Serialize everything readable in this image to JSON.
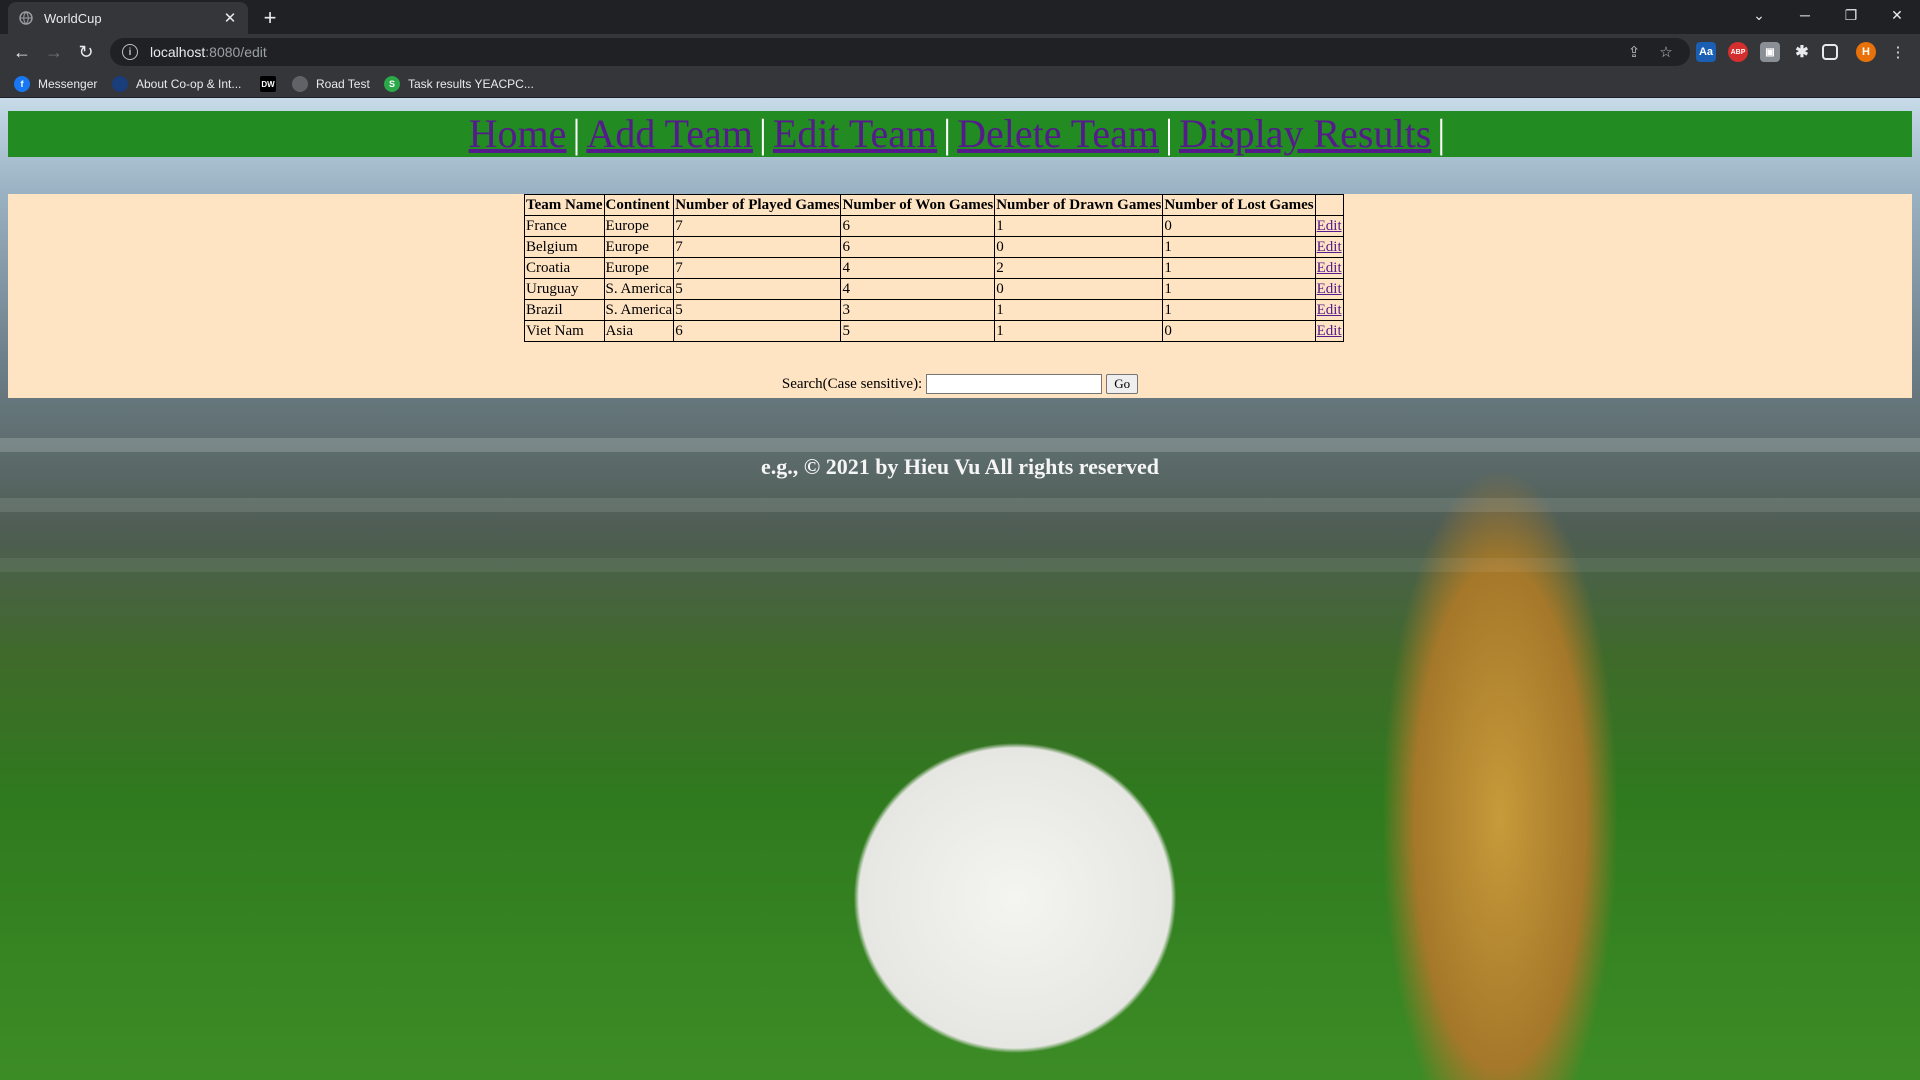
{
  "browser": {
    "tab_title": "WorldCup",
    "url_host": "localhost",
    "url_path": ":8080/edit",
    "bookmarks": [
      {
        "label": "Messenger",
        "color": "#1877f2",
        "glyph": "f"
      },
      {
        "label": "About Co-op & Int...",
        "color": "#1a3d7c",
        "glyph": ""
      },
      {
        "label": "",
        "color": "#000000",
        "glyph": "DW"
      },
      {
        "label": "Road Test",
        "color": "#5f6368",
        "glyph": ""
      },
      {
        "label": "Task results YEACPC...",
        "color": "#2aa84a",
        "glyph": "S"
      }
    ],
    "profile_initial": "H"
  },
  "nav": {
    "home": "Home",
    "add_team": "Add Team",
    "edit_team": "Edit Team",
    "delete_team": "Delete Team",
    "display_results": "Display Results",
    "separator": "|"
  },
  "table": {
    "headers": [
      "Team Name",
      "Continent",
      "Number of Played Games",
      "Number of Won Games",
      "Number of Drawn Games",
      "Number of Lost Games",
      ""
    ],
    "rows": [
      [
        "France",
        "Europe",
        "7",
        "6",
        "1",
        "0",
        "Edit"
      ],
      [
        "Belgium",
        "Europe",
        "7",
        "6",
        "0",
        "1",
        "Edit"
      ],
      [
        "Croatia",
        "Europe",
        "7",
        "4",
        "2",
        "1",
        "Edit"
      ],
      [
        "Uruguay",
        "S. America",
        "5",
        "4",
        "0",
        "1",
        "Edit"
      ],
      [
        "Brazil",
        "S. America",
        "5",
        "3",
        "1",
        "1",
        "Edit"
      ],
      [
        "Viet Nam",
        "Asia",
        "6",
        "5",
        "1",
        "0",
        "Edit"
      ]
    ]
  },
  "search": {
    "label": "Search(Case sensitive):",
    "value": "",
    "button": "Go"
  },
  "footer": "e.g., © 2021 by Hieu Vu All rights reserved",
  "colors": {
    "navbar_bg": "#228b22",
    "panel_bg": "#ffe4c4",
    "link": "#551a8b"
  }
}
